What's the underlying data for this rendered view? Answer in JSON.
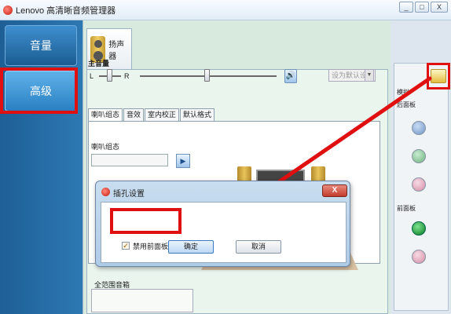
{
  "window": {
    "title": "Lenovo 高清晰音频管理器",
    "controls": [
      "_",
      "□",
      "X"
    ]
  },
  "nav": {
    "items": [
      {
        "label": "音量"
      },
      {
        "label": "高级"
      }
    ]
  },
  "device_tab": {
    "label": "扬声器",
    "icon": "speaker-icon"
  },
  "main_volume": {
    "label": "主音量",
    "left": "L",
    "right": "R",
    "default_device_label": "设为默认设备",
    "dropdown_arrow": "▼",
    "mute_glyph": "🔊"
  },
  "tabs": [
    {
      "label": "喇叭组态",
      "active": true
    },
    {
      "label": "音效",
      "active": false
    },
    {
      "label": "室内校正",
      "active": false
    },
    {
      "label": "默认格式",
      "active": false
    }
  ],
  "speaker_config": {
    "label": "喇叭组态",
    "play_glyph": "▶"
  },
  "full_range": {
    "label": "全范围音箱"
  },
  "right_panel": {
    "title": "模拟",
    "back_label": "后面板",
    "front_label": "前面板",
    "back_jacks": [
      "blue",
      "green",
      "pink"
    ],
    "front_jacks": [
      "active-green",
      "pink"
    ]
  },
  "dialog": {
    "title": "插孔设置",
    "close": "X",
    "checkbox_label": "禁用前面板插孔检测",
    "checkbox_checked": true,
    "checkbox_mark": "✓",
    "ok": "确定",
    "cancel": "取消"
  },
  "colors": {
    "highlight": "#e01010",
    "nav_bg": "#1e5f96",
    "accent": "#3b79c3"
  }
}
